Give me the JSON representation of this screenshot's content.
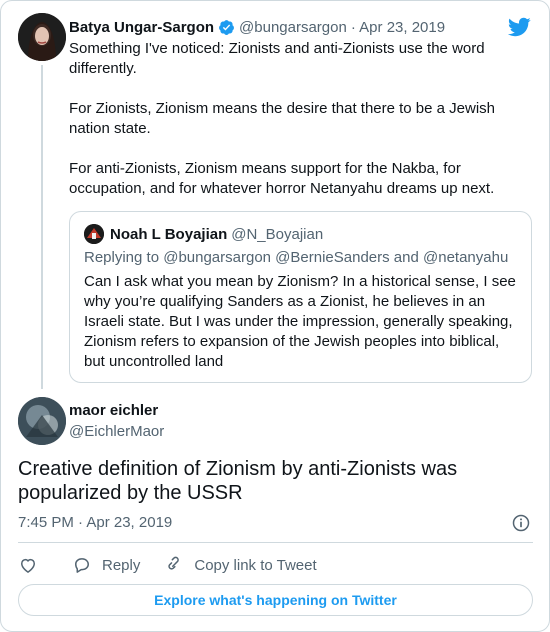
{
  "parent": {
    "name": "Batya Ungar-Sargon",
    "handle": "@bungarsargon",
    "date": "· Apr 23, 2019",
    "text": "Something I've noticed: Zionists and anti-Zionists use the word differently.\n\nFor Zionists, Zionism means the desire that there to be a Jewish nation state.\n\nFor anti-Zionists, Zionism means support for the Nakba, for occupation, and for whatever horror Netanyahu dreams up next."
  },
  "quoted": {
    "name": "Noah L Boyajian",
    "handle": "@N_Boyajian",
    "replying": "Replying to @bungarsargon @BernieSanders and @netanyahu",
    "text": "Can I ask what you mean by Zionism? In a historical sense, I see why you’re qualifying Sanders as a Zionist, he believes in an Israeli state. But I was under the impression, generally speaking, Zionism refers to expansion of the Jewish peoples into biblical, but uncontrolled land"
  },
  "main": {
    "name": "maor eichler",
    "handle": "@EichlerMaor",
    "text": "Creative definition of Zionism by anti-Zionists was popularized by the USSR",
    "timestamp": "7:45 PM · Apr 23, 2019"
  },
  "actions": {
    "like_icon": "heart-icon",
    "reply_label": "Reply",
    "copy_label": "Copy link to Tweet"
  },
  "explore_label": "Explore what's happening on Twitter",
  "colors": {
    "accent": "#1d9bf0",
    "muted": "#536471",
    "border": "#cfd9de"
  }
}
